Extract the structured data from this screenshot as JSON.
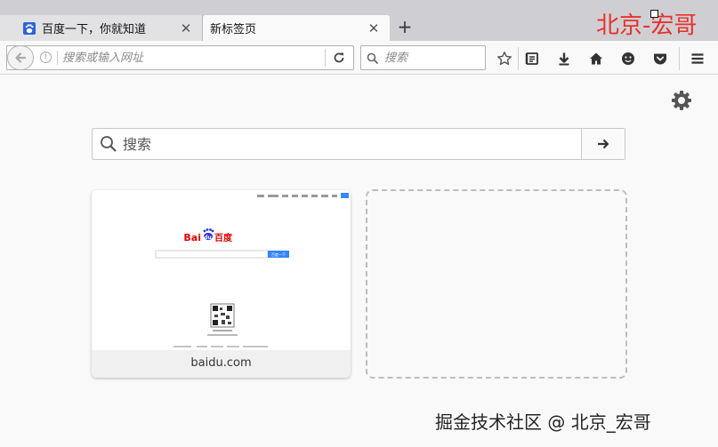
{
  "tabs": [
    {
      "label": "百度一下，你就知道",
      "favicon": "baidu-paw-icon",
      "active": false
    },
    {
      "label": "新标签页",
      "active": true
    }
  ],
  "brand_text": "北京-宏哥",
  "toolbar": {
    "url_placeholder": "搜索或输入网址",
    "search_placeholder": "搜索"
  },
  "content": {
    "search_placeholder": "搜索",
    "tiles": [
      {
        "title": "baidu.com",
        "thumbnail": {
          "logo_text_red": "Bai",
          "logo_text_blue": "du",
          "logo_text_cn": "百度",
          "button_label": "百度一下"
        }
      }
    ]
  },
  "watermark": "掘金技术社区 @ 北京_宏哥",
  "colors": {
    "brand": "#e8312a",
    "baidu_red": "#e10601",
    "baidu_blue": "#2932e1"
  }
}
